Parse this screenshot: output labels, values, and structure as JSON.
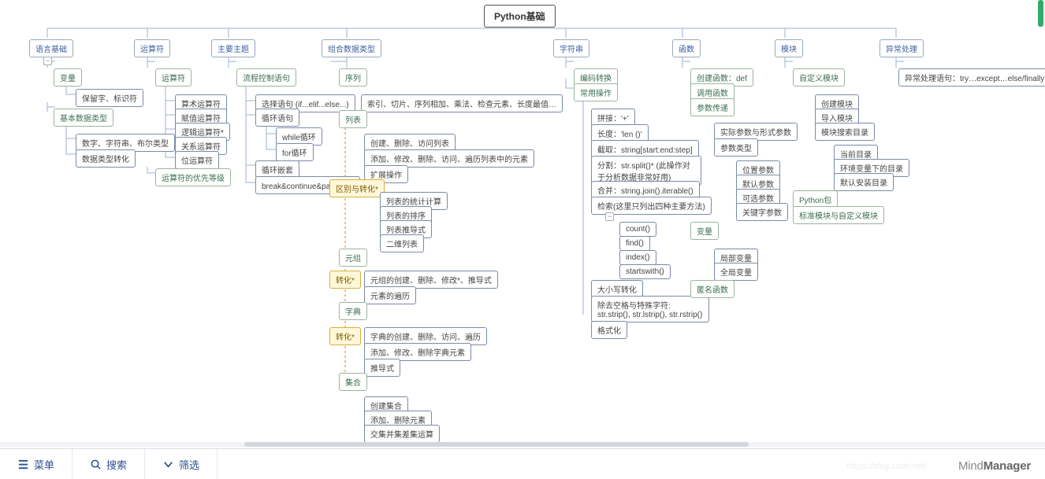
{
  "root": "Python基础",
  "toolbar": {
    "menu": "菜单",
    "search": "搜索",
    "filter": "筛选"
  },
  "brand": {
    "a": "Mind",
    "b": "Manager"
  },
  "url_wm": "https://blog.csdn.net/",
  "b1": {
    "title": "语言基础",
    "n1": "变量",
    "n1a": "保留字、标识符",
    "n2": "基本数据类型",
    "n2a": "数字、字符串、布尔类型",
    "n2b": "数据类型转化"
  },
  "b2": {
    "title": "运算符",
    "n1": "运算符",
    "n1a": "算术运算符",
    "n1b": "赋值运算符",
    "n1c": "逻辑运算符*",
    "n1d": "关系运算符",
    "n1e": "位运算符",
    "n2": "运算符的优先等级"
  },
  "b3": {
    "title": "主要主题",
    "n1": "流程控制语句",
    "n1a": "选择语句 (if...elif...else...)",
    "n1b": "循环语句",
    "n1b1": "while循环",
    "n1b2": "for循环",
    "n1c": "循环嵌套",
    "n1d": "break&continue&pass语句"
  },
  "b4": {
    "title": "组合数据类型",
    "seq": "序列",
    "seq_d": "索引、切片、序列相加、乘法、检查元素、长度最值…",
    "list": "列表",
    "list_a": "创建、删除、访问列表",
    "list_b": "添加、修改、删除、访问、遍历列表中的元素",
    "list_c": "扩展操作",
    "qb": "区别与转化*",
    "qb_a": "列表的统计计算",
    "qb_b": "列表的排序",
    "qb_c": "列表推导式",
    "qb_d": "二维列表",
    "tuple": "元组",
    "conv1": "转化*",
    "tuple_a": "元组的创建、删除、修改*、推导式",
    "tuple_b": "元素的遍历",
    "dict": "字典",
    "conv2": "转化*",
    "dict_a": "字典的创建、删除、访问、遍历",
    "dict_b": "添加、修改、删除字典元素",
    "dict_c": "推导式",
    "set": "集合",
    "set_a": "创建集合",
    "set_b": "添加、删除元素",
    "set_c": "交集并集差集运算"
  },
  "b5": {
    "title": "字符串",
    "n1": "编码转换",
    "n2": "常用操作",
    "a": "拼接：'+'",
    "b": "长度：'len ()' ",
    "c": "截取：string[start:end:step]",
    "d": "分割：str.split()*\n(此操作对于分析数据非常好用)",
    "e": "合并：string.join().iterable()",
    "f": "检索(这里只列出四种主要方法)",
    "f1": "count()",
    "f2": "find()",
    "f3": "index()",
    "f4": "startswith()",
    "g": "大小写转化",
    "h": "除去空格与特殊字符: str.strip(), str.lstrip(), str.rstrip()",
    "i": "格式化"
  },
  "b6": {
    "title": "函数",
    "n1": "创建函数：def",
    "n2": "调用函数",
    "n3": "参数传递",
    "n3a": "实际参数与形式参数",
    "n3b": "参数类型",
    "p1": "位置参数",
    "p2": "默认参数",
    "p3": "可选参数",
    "p4": "关键字参数",
    "n4": "变量",
    "v1": "局部变量",
    "v2": "全局变量",
    "n5": "匿名函数"
  },
  "b7": {
    "title": "模块",
    "n1": "自定义模块",
    "a": "创建模块",
    "b": "导入模块",
    "c": "模块搜索目录",
    "c1": "当前目录",
    "c2": "环境变量下的目录",
    "c3": "默认安装目录",
    "n2": "Python包",
    "n3": "标准模块与自定义模块"
  },
  "b8": {
    "title": "异常处理",
    "n1": "异常处理语句：try…except…else/finally"
  }
}
